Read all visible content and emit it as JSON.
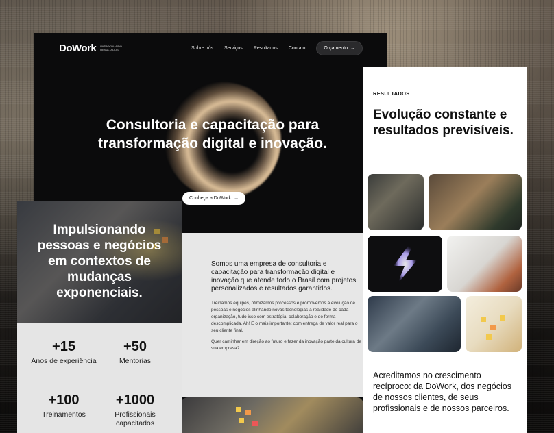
{
  "nav": {
    "logo": "DoWork",
    "tagline": "PATROCINANDO RESULTADOS",
    "links": [
      "Sobre nós",
      "Serviços",
      "Resultados",
      "Contato"
    ],
    "cta": "Orçamento",
    "cta_arrow": "→"
  },
  "hero": {
    "title": "Consultoria e capacitação para transformação digital e inovação.",
    "button": "Conheça a DoWork",
    "button_arrow": "→"
  },
  "about": {
    "lead": "Somos uma empresa de consultoria e capacitação para transformação digital e inovação que atende todo o Brasil com projetos personalizados e resultados garantidos.",
    "body": "Treinamos equipes, otimizamos processos e promovemos a evolução de pessoas e negócios alinhando novas tecnologias à realidade de cada organização, tudo isso com estratégia, colaboração e de forma descomplicada. Ah! E o mais importante: com entrega de valor real para o seu cliente final.",
    "question": "Quer caminhar em direção ao futuro e fazer da inovação parte da cultura de sua empresa?"
  },
  "impulse": {
    "title": "Impulsionando pessoas e negócios em contextos de mudanças exponenciais."
  },
  "stats": [
    {
      "value": "+15",
      "label": "Anos de experiência"
    },
    {
      "value": "+50",
      "label": "Mentorias"
    },
    {
      "value": "+100",
      "label": "Treinamentos"
    },
    {
      "value": "+1000",
      "label": "Profissionais capacitados"
    }
  ],
  "results": {
    "kicker": "RESULTADOS",
    "title": "Evolução constante e resultados previsíveis.",
    "footer": "Acreditamos no crescimento recíproco: da DoWork, dos negócios de nossos clientes, de seus profissionais e de nossos parceiros."
  },
  "colors": {
    "dark": "#0d0d0e",
    "light_gray": "#e7e7e7",
    "white": "#ffffff",
    "glow": "#e6c89e",
    "sticky_note": "#f2c94c"
  }
}
